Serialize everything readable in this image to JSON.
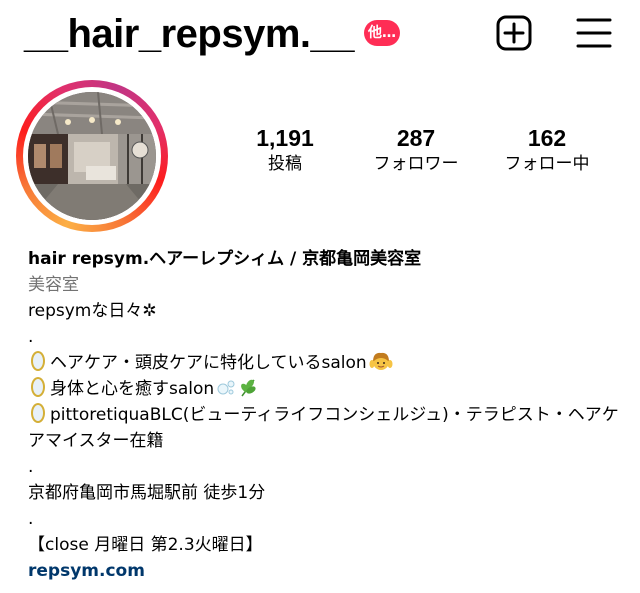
{
  "header": {
    "username": "__hair_repsym.__",
    "badge_label": "他…",
    "accent_badge_color": "#ff2d55",
    "create_icon": "plus-square-icon",
    "menu_icon": "hamburger-menu-icon"
  },
  "avatar": {
    "ring_gradient": [
      "#fcaf45",
      "#f77737",
      "#fd1d1d",
      "#e1306c",
      "#c13584"
    ]
  },
  "stats": [
    {
      "value": "1,191",
      "label": "投稿"
    },
    {
      "value": "287",
      "label": "フォロワー"
    },
    {
      "value": "162",
      "label": "フォロー中"
    }
  ],
  "bio": {
    "name": "hair repsym.ヘアーレプシィム / 京都亀岡美容室",
    "category": "美容室",
    "line1": "repsymな日々✲",
    "dot1": ".",
    "line2": "ヘアケア・頭皮ケアに特化しているsalon",
    "line3": "身体と心を癒すsalon",
    "line4": "pittoretiquaBLC(ビューティライフコンシェルジュ)・テラピスト・ヘアケアマイスター在籍",
    "dot2": ".",
    "line5": "京都府亀岡市馬堀駅前 徒歩1分",
    "dot3": ".",
    "line6": "【close 月曜日 第2.3火曜日】",
    "link": "repsym.com",
    "link_color": "#00376b",
    "category_color": "#737373",
    "icons": [
      "mirror-icon",
      "woman-massage-icon",
      "bubbles-icon",
      "herb-icon"
    ]
  }
}
